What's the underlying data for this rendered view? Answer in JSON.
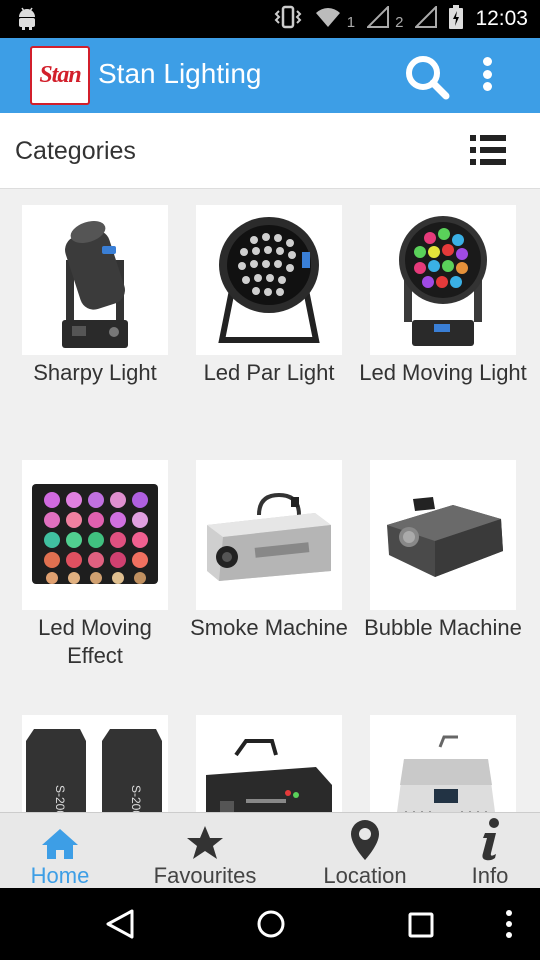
{
  "status_bar": {
    "time": "12:03",
    "sim1": "1",
    "sim2": "2",
    "icons": [
      "android-icon",
      "vibrate-icon",
      "wifi-icon",
      "signal-icon",
      "signal-icon",
      "battery-icon"
    ]
  },
  "app_bar": {
    "logo_text": "Stan",
    "title": "Stan Lighting",
    "icons": [
      "search-icon",
      "more-vert-icon"
    ],
    "color": "#3d9ee6"
  },
  "section": {
    "title": "Categories",
    "view_toggle_icon": "list-view-icon"
  },
  "categories": [
    {
      "label": "Sharpy Light",
      "image": "moving-head-light"
    },
    {
      "label": "Led Par Light",
      "image": "led-par-can"
    },
    {
      "label": "Led Moving Light",
      "image": "led-moving-head-wash"
    },
    {
      "label": "Led Moving Effect",
      "image": "led-matrix-panel"
    },
    {
      "label": "Smoke Machine",
      "image": "fog-machine"
    },
    {
      "label": "Bubble Machine",
      "image": "bubble-machine"
    },
    {
      "label": "",
      "image": "cold-spark-machines"
    },
    {
      "label": "",
      "image": "laser-projector"
    },
    {
      "label": "",
      "image": "dmx-console"
    }
  ],
  "bottom_nav": [
    {
      "label": "Home",
      "icon": "home-icon",
      "active": true
    },
    {
      "label": "Favourites",
      "icon": "star-icon",
      "active": false
    },
    {
      "label": "Location",
      "icon": "location-pin-icon",
      "active": false
    },
    {
      "label": "Info",
      "icon": "info-icon",
      "active": false
    }
  ],
  "colors": {
    "accent": "#3d9ee6",
    "logo_red": "#d21f2b",
    "nav_inactive": "#444444"
  }
}
